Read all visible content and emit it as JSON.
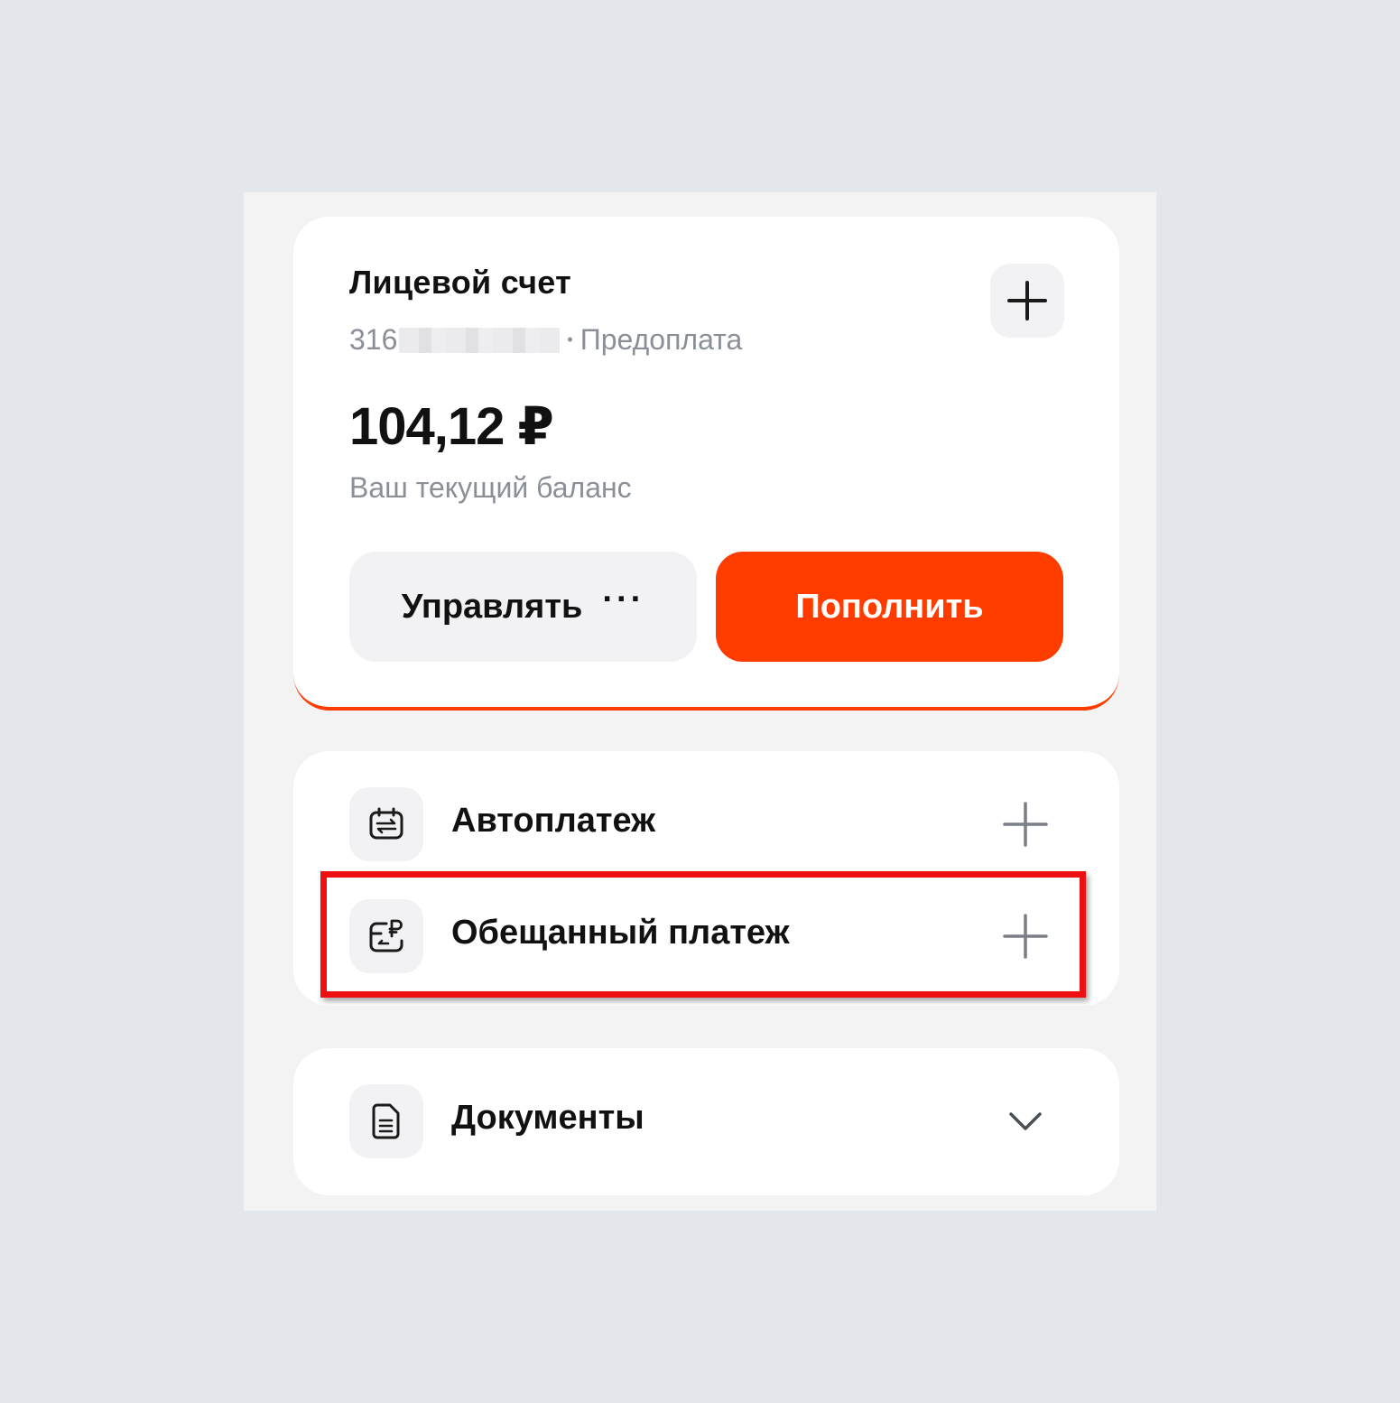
{
  "account": {
    "title": "Лицевой счет",
    "number_prefix": "316",
    "number_suffix": " ",
    "tariff": "Предоплата",
    "balance": "104,12 ₽",
    "balance_caption": "Ваш текущий баланс",
    "add_button_icon": "plus-icon",
    "manage_label": "Управлять",
    "manage_icon": "more-dots-icon",
    "topup_label": "Пополнить"
  },
  "services": {
    "items": [
      {
        "label": "Автоплатеж",
        "icon": "autopay-icon",
        "action_icon": "plus-icon"
      },
      {
        "label": "Обещанный платеж",
        "icon": "promised-payment-icon",
        "action_icon": "plus-icon",
        "highlighted": true
      }
    ]
  },
  "documents": {
    "label": "Документы",
    "icon": "document-icon",
    "action_icon": "chevron-down-icon"
  },
  "colors": {
    "accent": "#ff3c00",
    "highlight": "#ee1010",
    "page_bg": "#e3e7eb",
    "panel_bg": "#f3f3f4",
    "muted_text": "#8a8f98"
  }
}
